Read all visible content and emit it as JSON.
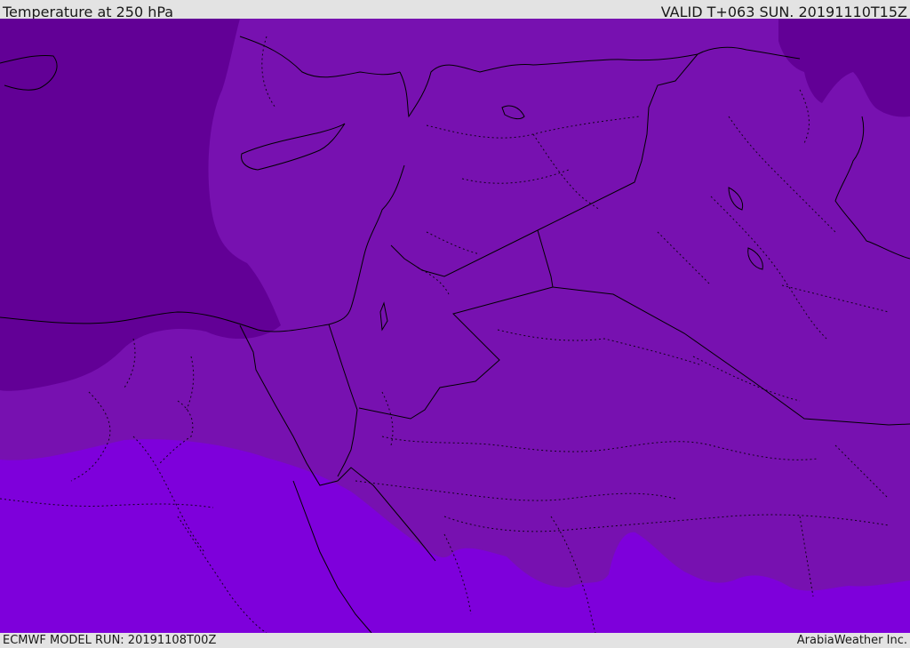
{
  "header": {
    "title": "Temperature at 250 hPa",
    "valid_time": "VALID T+063 SUN. 20191110T15Z"
  },
  "footer": {
    "model_run": "ECMWF MODEL RUN: 20191108T00Z",
    "credit": "ArabiaWeather Inc."
  },
  "map": {
    "variable": "temperature",
    "level": "250 hPa",
    "colors": {
      "coldest_band": "#620096",
      "middle_band": "#7711b0",
      "warm_band": "#7e00db",
      "boundary_line": "#000000"
    },
    "region_labels": []
  }
}
